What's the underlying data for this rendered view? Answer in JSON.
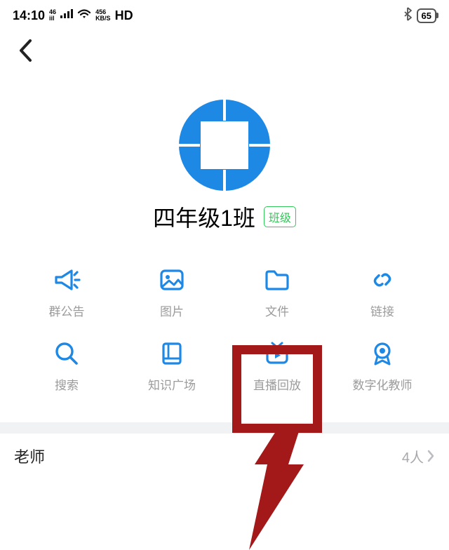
{
  "status": {
    "time": "14:10",
    "network_4g_top": "46",
    "network_4g_bottom": "iil",
    "kb_top": "456",
    "kb_bottom": "KB/S",
    "hd": "HD",
    "battery": "65"
  },
  "class": {
    "name": "四年级1班",
    "badge": "班级"
  },
  "grid": [
    {
      "label": "群公告",
      "icon": "megaphone-icon"
    },
    {
      "label": "图片",
      "icon": "image-icon"
    },
    {
      "label": "文件",
      "icon": "folder-icon"
    },
    {
      "label": "链接",
      "icon": "link-icon"
    },
    {
      "label": "搜索",
      "icon": "search-icon"
    },
    {
      "label": "知识广场",
      "icon": "book-icon"
    },
    {
      "label": "直播回放",
      "icon": "tv-play-icon"
    },
    {
      "label": "数字化教师",
      "icon": "medal-icon"
    }
  ],
  "teacher": {
    "label": "老师",
    "count": "4人"
  },
  "colors": {
    "blue": "#1e88e5",
    "green": "#34c759",
    "highlight": "#a31818"
  }
}
